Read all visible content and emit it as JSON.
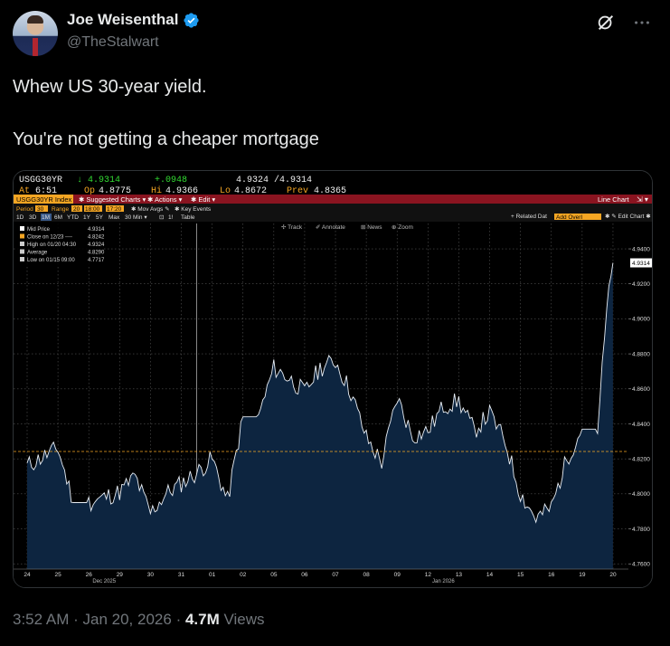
{
  "post": {
    "display_name": "Joe Weisenthal",
    "handle": "@TheStalwart",
    "text": "Whew US 30-year yield.\n\nYou're not getting a cheaper mortgage",
    "time": "3:52 AM",
    "separator": "·",
    "date": "Jan 20, 2026",
    "views_count": "4.7M",
    "views_label": "Views",
    "icons": [
      "verified-badge-icon",
      "grok-icon",
      "more-icon"
    ]
  },
  "terminal": {
    "ticker": "USGG30YR",
    "last": "↓ 4.9314",
    "change": "+.0948",
    "bid_ask": "4.9324 /4.9314",
    "at_label": "At",
    "at_time": "6:51",
    "op_label": "Op",
    "op": "4.8775",
    "hi_label": "Hi",
    "hi": "4.9366",
    "lo_label": "Lo",
    "lo": "4.8672",
    "prev_label": "Prev",
    "prev": "4.8365",
    "index_label": "USGG30YR Index",
    "menu_suggested": "✱ Suggested Charts ▾",
    "menu_actions": "✱ Actions ▾",
    "menu_edit": "✱ Edit ▾",
    "menu_type": "Line Chart",
    "period_label": "Period",
    "period_value": "30",
    "range_label": "Range",
    "range_value": "20",
    "range_time1": "18:00",
    "range_time2": "17:20",
    "mov_avgs": "✱ Mov Avgs ✎",
    "key_events": "✱ Key Events",
    "periods": [
      "1D",
      "3D",
      "1M",
      "6M",
      "YTD",
      "1Y",
      "5Y",
      "Max",
      "30 Min ▾",
      "⊡",
      "1!",
      "Table"
    ],
    "related_label": "+ Related Dat",
    "related_value": "Add Overl",
    "edit_chart": "✱ ✎ Edit Chart ✱",
    "tools": [
      "✢ Track",
      "✐ Annotate",
      "⊞ News",
      "⊕ Zoom"
    ],
    "legend": [
      {
        "key": "mid",
        "color": "#ffffff",
        "label": "Mid Price",
        "value": "4.9314"
      },
      {
        "key": "close",
        "color": "#f5a623",
        "label": "Close on 12/23 ---- ",
        "value": "4.8242"
      },
      {
        "key": "high",
        "color": "#cccccc",
        "label": "High on 01/20 04:30",
        "value": "4.9324"
      },
      {
        "key": "avg",
        "color": "#cccccc",
        "label": "Average",
        "value": "4.8290"
      },
      {
        "key": "low",
        "color": "#cccccc",
        "label": "Low on 01/15 09:00",
        "value": "4.7717"
      }
    ],
    "last_price_label": "4.9314"
  },
  "chart_data": {
    "type": "area",
    "title": "USGG30YR Index",
    "ylim": [
      4.757,
      4.9545
    ],
    "y_ticks": [
      "4.9400",
      "4.9200",
      "4.9000",
      "4.8800",
      "4.8600",
      "4.8400",
      "4.8200",
      "4.8000",
      "4.7800",
      "4.7600"
    ],
    "x_tick_labels": [
      "24",
      "25",
      "26",
      "29",
      "30",
      "31",
      "01",
      "02",
      "05",
      "06",
      "07",
      "08",
      "09",
      "12",
      "13",
      "14",
      "15",
      "16",
      "19",
      "20"
    ],
    "month_labels": [
      "Dec 2025",
      "Jan 2026"
    ],
    "reference_line": {
      "label": "Close on 12/23",
      "value": 4.8242
    },
    "grid": true,
    "legend_position": "top-left",
    "series": [
      {
        "name": "Mid Price",
        "x": [
          0,
          1.0,
          1.5,
          2.0,
          3.0,
          3.5,
          4.0,
          4.5,
          5.5,
          6.0,
          6.5,
          7.0,
          7.5,
          8.0,
          8.5,
          9.0,
          9.5,
          10.0,
          10.5,
          11.0,
          11.5,
          12.0,
          12.5,
          13.0,
          13.5,
          14.0,
          14.5,
          15.0,
          15.5,
          16.0,
          16.5,
          17.0,
          17.5,
          18.0,
          18.5,
          18.8,
          19.0
        ],
        "y": [
          4.816,
          4.826,
          4.795,
          4.795,
          4.801,
          4.81,
          4.789,
          4.8,
          4.812,
          4.82,
          4.796,
          4.844,
          4.844,
          4.872,
          4.866,
          4.858,
          4.872,
          4.876,
          4.858,
          4.832,
          4.818,
          4.855,
          4.833,
          4.836,
          4.85,
          4.853,
          4.836,
          4.846,
          4.83,
          4.8,
          4.786,
          4.792,
          4.82,
          4.837,
          4.837,
          4.905,
          4.932
        ]
      }
    ]
  }
}
